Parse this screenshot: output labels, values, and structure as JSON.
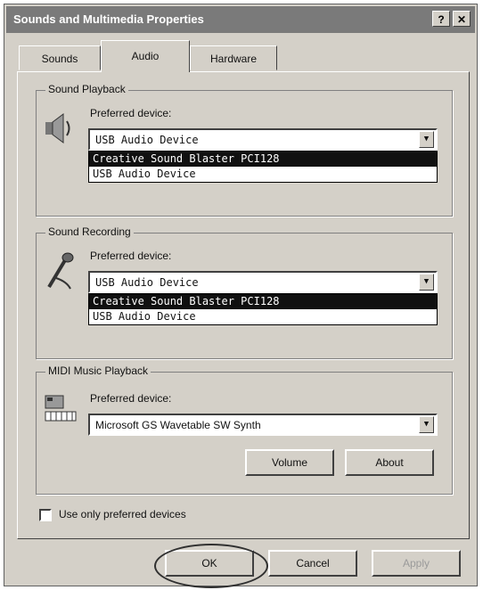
{
  "window": {
    "title": "Sounds and Multimedia Properties",
    "help_glyph": "?",
    "close_glyph": "✕"
  },
  "tabs": [
    {
      "label": "Sounds",
      "active": false
    },
    {
      "label": "Audio",
      "active": true
    },
    {
      "label": "Hardware",
      "active": false
    }
  ],
  "sound_playback": {
    "group_label": "Sound Playback",
    "icon": "speaker-icon",
    "preferred_label": "Preferred device:",
    "selected": "USB Audio Device",
    "options": [
      "Creative Sound Blaster PCI128",
      "USB Audio Device"
    ],
    "highlighted_option": "Creative Sound Blaster PCI128"
  },
  "sound_recording": {
    "group_label": "Sound Recording",
    "icon": "microphone-icon",
    "preferred_label": "Preferred device:",
    "selected": "USB Audio Device",
    "options": [
      "Creative Sound Blaster PCI128",
      "USB Audio Device"
    ],
    "highlighted_option": "Creative Sound Blaster PCI128"
  },
  "midi_playback": {
    "group_label": "MIDI Music Playback",
    "icon": "midi-keyboard-icon",
    "preferred_label": "Preferred device:",
    "selected": "Microsoft GS Wavetable SW Synth",
    "volume_label": "Volume",
    "about_label": "About"
  },
  "use_only_preferred": {
    "label": "Use only preferred devices",
    "checked": false
  },
  "footer": {
    "ok_label": "OK",
    "cancel_label": "Cancel",
    "apply_label": "Apply",
    "apply_enabled": false
  },
  "colors": {
    "dialog_bg": "#d4d0c8",
    "titlebar_bg": "#7a7a7a",
    "selection_bg": "#101010"
  }
}
